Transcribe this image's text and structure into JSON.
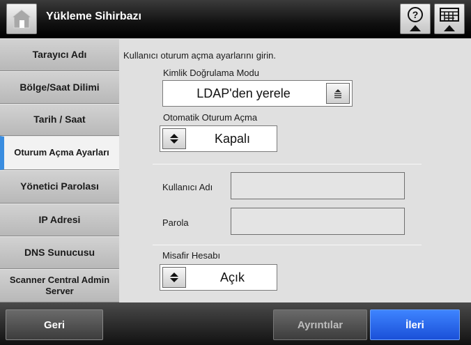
{
  "titlebar": {
    "title": "Yükleme Sihirbazı",
    "home_icon": "home-icon",
    "help_icon": "help-icon",
    "keyboard_icon": "keyboard-icon"
  },
  "sidebar": {
    "items": [
      {
        "label": "Tarayıcı Adı"
      },
      {
        "label": "Bölge/Saat Dilimi"
      },
      {
        "label": "Tarih / Saat"
      },
      {
        "label": "Oturum Açma Ayarları",
        "active": true
      },
      {
        "label": "Yönetici Parolası"
      },
      {
        "label": "IP Adresi"
      },
      {
        "label": "DNS Sunucusu"
      },
      {
        "label": "Scanner Central Admin Server"
      }
    ],
    "accent_color": "#3a8de0"
  },
  "main": {
    "instruction": "Kullanıcı oturum açma ayarlarını girin.",
    "auth_mode": {
      "label": "Kimlik Doğrulama Modu",
      "value": "LDAP'den yerele"
    },
    "auto_login": {
      "label": "Otomatik Oturum Açma",
      "value": "Kapalı"
    },
    "username": {
      "label": "Kullanıcı Adı",
      "value": ""
    },
    "password": {
      "label": "Parola",
      "value": ""
    },
    "guest_account": {
      "label": "Misafir Hesabı",
      "value": "Açık"
    }
  },
  "footer": {
    "back": "Geri",
    "details": "Ayrıntılar",
    "next": "İleri",
    "next_color": "#1a50d8"
  }
}
